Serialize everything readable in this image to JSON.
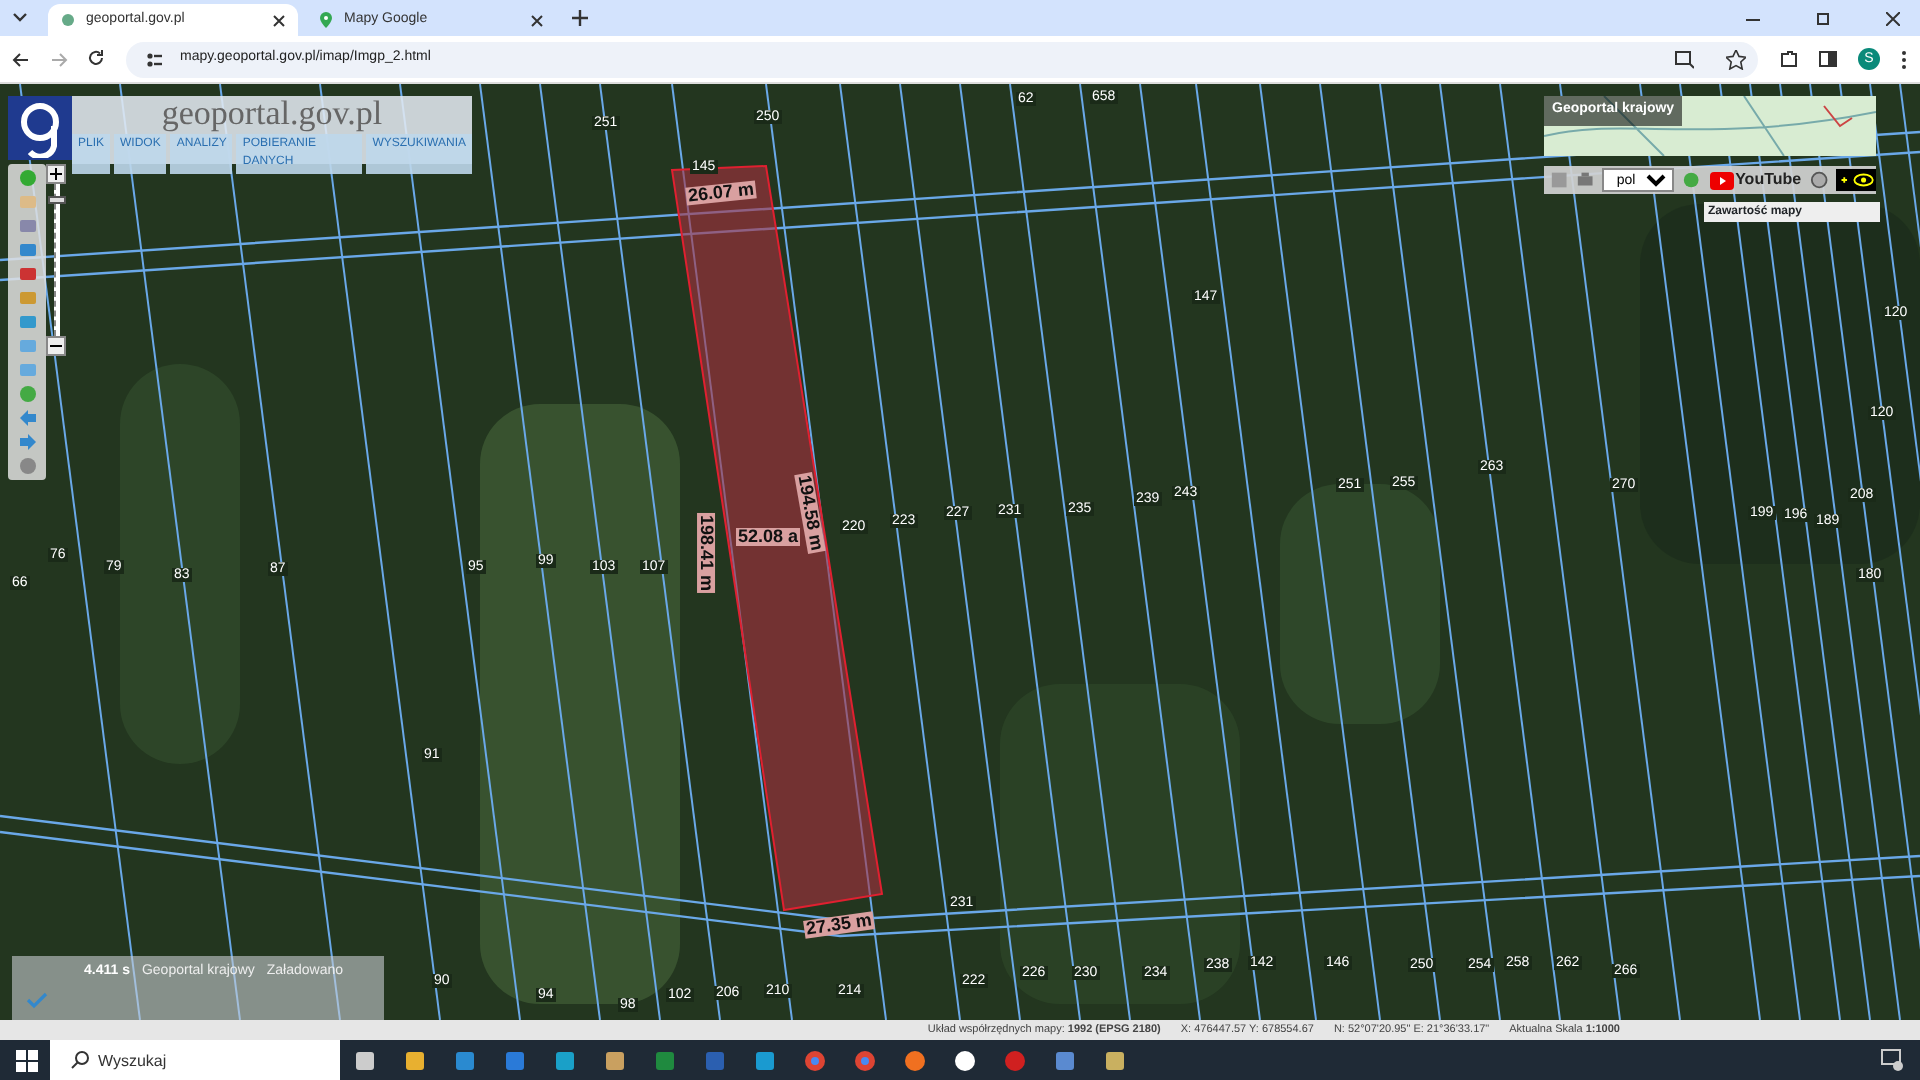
{
  "browser": {
    "tabs": [
      {
        "title": "geoportal.gov.pl",
        "selected": true
      },
      {
        "title": "Mapy Google",
        "selected": false
      }
    ],
    "address": "mapy.geoportal.gov.pl/imap/Imgp_2.html",
    "profile_initial": "S"
  },
  "geoportal": {
    "logo_text": "geoportal.gov.pl",
    "menu": [
      "PLIK",
      "WIDOK",
      "ANALIZY",
      "POBIERANIE DANYCH",
      "WYSZUKIWANIA"
    ],
    "overview_title": "Geoportal krajowy",
    "language": "pol",
    "youtube": "YouTube",
    "map_contents": "Zawartość mapy"
  },
  "map": {
    "parcel_labels": [
      "251",
      "250",
      "62",
      "658",
      "145",
      "147",
      "76",
      "79",
      "83",
      "87",
      "95",
      "99",
      "103",
      "107",
      "66",
      "91",
      "220",
      "223",
      "227",
      "231",
      "235",
      "239",
      "243",
      "251",
      "255",
      "263",
      "270",
      "199",
      "196",
      "189",
      "180",
      "120",
      "120",
      "208",
      "231",
      "90",
      "94",
      "98",
      "102",
      "206",
      "210",
      "214",
      "222",
      "226",
      "230",
      "234",
      "238",
      "142",
      "146",
      "250",
      "254",
      "258",
      "262",
      "266"
    ],
    "measurements": [
      "26.07 m",
      "52.08 a",
      "194.58 m",
      "198.41 m",
      "27.35 m"
    ],
    "zoom_slider": {
      "level": 0.9
    }
  },
  "load_panel": {
    "time": "4.411 s",
    "source": "Geoportal krajowy",
    "status": "Załadowano"
  },
  "status_bar": {
    "crs": "Układ współrzędnych mapy: **1992 (EPSG 2180)**",
    "xy": "X: 476447.57 Y: 678554.67",
    "geo": "N: 52°07'20.95\" E: 21°36'33.17\"",
    "scale": "Aktualna Skala **1:1000**"
  },
  "taskbar": {
    "search_placeholder": "Wyszukaj"
  }
}
